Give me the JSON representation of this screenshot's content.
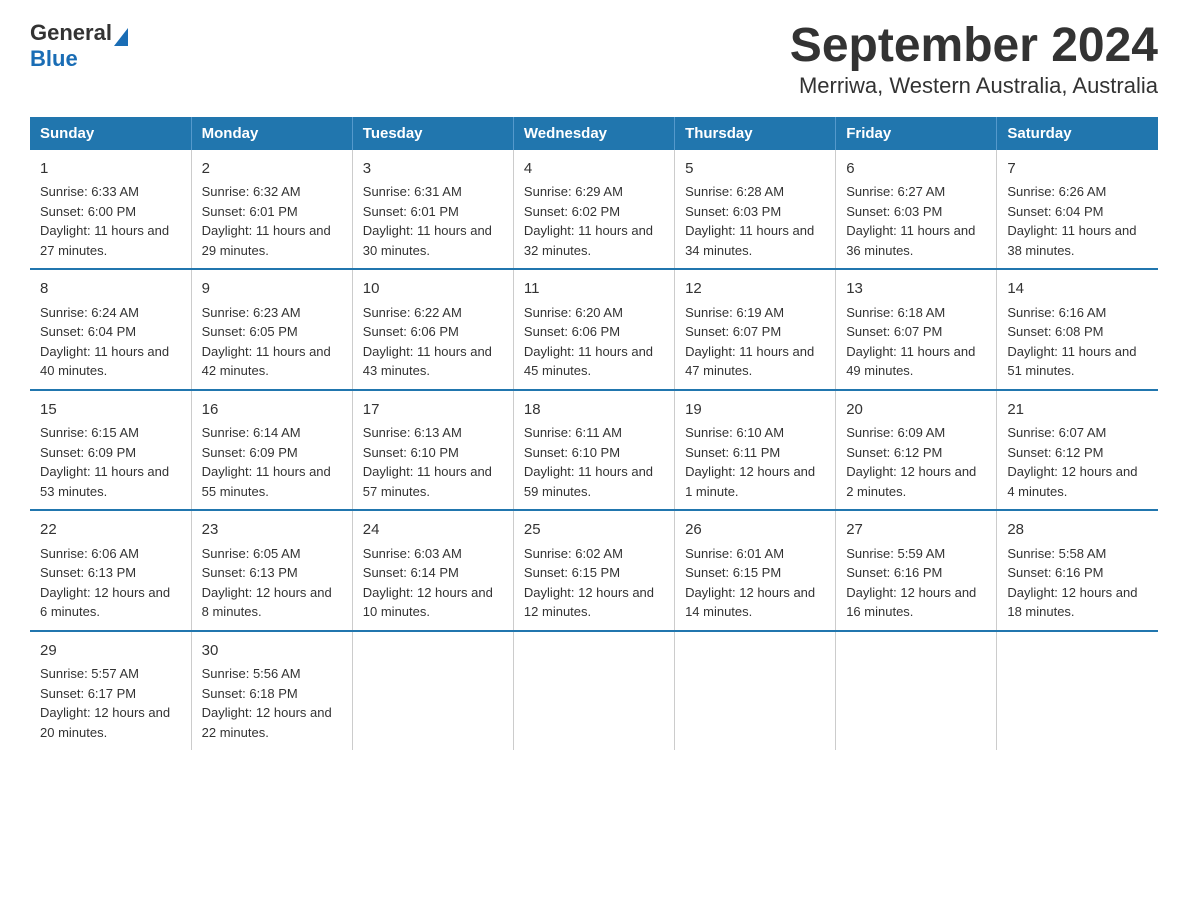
{
  "logo": {
    "general": "General",
    "triangle": "",
    "blue": "Blue"
  },
  "title": "September 2024",
  "subtitle": "Merriwa, Western Australia, Australia",
  "days_of_week": [
    "Sunday",
    "Monday",
    "Tuesday",
    "Wednesday",
    "Thursday",
    "Friday",
    "Saturday"
  ],
  "weeks": [
    [
      {
        "day": "1",
        "sunrise": "6:33 AM",
        "sunset": "6:00 PM",
        "daylight": "11 hours and 27 minutes."
      },
      {
        "day": "2",
        "sunrise": "6:32 AM",
        "sunset": "6:01 PM",
        "daylight": "11 hours and 29 minutes."
      },
      {
        "day": "3",
        "sunrise": "6:31 AM",
        "sunset": "6:01 PM",
        "daylight": "11 hours and 30 minutes."
      },
      {
        "day": "4",
        "sunrise": "6:29 AM",
        "sunset": "6:02 PM",
        "daylight": "11 hours and 32 minutes."
      },
      {
        "day": "5",
        "sunrise": "6:28 AM",
        "sunset": "6:03 PM",
        "daylight": "11 hours and 34 minutes."
      },
      {
        "day": "6",
        "sunrise": "6:27 AM",
        "sunset": "6:03 PM",
        "daylight": "11 hours and 36 minutes."
      },
      {
        "day": "7",
        "sunrise": "6:26 AM",
        "sunset": "6:04 PM",
        "daylight": "11 hours and 38 minutes."
      }
    ],
    [
      {
        "day": "8",
        "sunrise": "6:24 AM",
        "sunset": "6:04 PM",
        "daylight": "11 hours and 40 minutes."
      },
      {
        "day": "9",
        "sunrise": "6:23 AM",
        "sunset": "6:05 PM",
        "daylight": "11 hours and 42 minutes."
      },
      {
        "day": "10",
        "sunrise": "6:22 AM",
        "sunset": "6:06 PM",
        "daylight": "11 hours and 43 minutes."
      },
      {
        "day": "11",
        "sunrise": "6:20 AM",
        "sunset": "6:06 PM",
        "daylight": "11 hours and 45 minutes."
      },
      {
        "day": "12",
        "sunrise": "6:19 AM",
        "sunset": "6:07 PM",
        "daylight": "11 hours and 47 minutes."
      },
      {
        "day": "13",
        "sunrise": "6:18 AM",
        "sunset": "6:07 PM",
        "daylight": "11 hours and 49 minutes."
      },
      {
        "day": "14",
        "sunrise": "6:16 AM",
        "sunset": "6:08 PM",
        "daylight": "11 hours and 51 minutes."
      }
    ],
    [
      {
        "day": "15",
        "sunrise": "6:15 AM",
        "sunset": "6:09 PM",
        "daylight": "11 hours and 53 minutes."
      },
      {
        "day": "16",
        "sunrise": "6:14 AM",
        "sunset": "6:09 PM",
        "daylight": "11 hours and 55 minutes."
      },
      {
        "day": "17",
        "sunrise": "6:13 AM",
        "sunset": "6:10 PM",
        "daylight": "11 hours and 57 minutes."
      },
      {
        "day": "18",
        "sunrise": "6:11 AM",
        "sunset": "6:10 PM",
        "daylight": "11 hours and 59 minutes."
      },
      {
        "day": "19",
        "sunrise": "6:10 AM",
        "sunset": "6:11 PM",
        "daylight": "12 hours and 1 minute."
      },
      {
        "day": "20",
        "sunrise": "6:09 AM",
        "sunset": "6:12 PM",
        "daylight": "12 hours and 2 minutes."
      },
      {
        "day": "21",
        "sunrise": "6:07 AM",
        "sunset": "6:12 PM",
        "daylight": "12 hours and 4 minutes."
      }
    ],
    [
      {
        "day": "22",
        "sunrise": "6:06 AM",
        "sunset": "6:13 PM",
        "daylight": "12 hours and 6 minutes."
      },
      {
        "day": "23",
        "sunrise": "6:05 AM",
        "sunset": "6:13 PM",
        "daylight": "12 hours and 8 minutes."
      },
      {
        "day": "24",
        "sunrise": "6:03 AM",
        "sunset": "6:14 PM",
        "daylight": "12 hours and 10 minutes."
      },
      {
        "day": "25",
        "sunrise": "6:02 AM",
        "sunset": "6:15 PM",
        "daylight": "12 hours and 12 minutes."
      },
      {
        "day": "26",
        "sunrise": "6:01 AM",
        "sunset": "6:15 PM",
        "daylight": "12 hours and 14 minutes."
      },
      {
        "day": "27",
        "sunrise": "5:59 AM",
        "sunset": "6:16 PM",
        "daylight": "12 hours and 16 minutes."
      },
      {
        "day": "28",
        "sunrise": "5:58 AM",
        "sunset": "6:16 PM",
        "daylight": "12 hours and 18 minutes."
      }
    ],
    [
      {
        "day": "29",
        "sunrise": "5:57 AM",
        "sunset": "6:17 PM",
        "daylight": "12 hours and 20 minutes."
      },
      {
        "day": "30",
        "sunrise": "5:56 AM",
        "sunset": "6:18 PM",
        "daylight": "12 hours and 22 minutes."
      },
      null,
      null,
      null,
      null,
      null
    ]
  ],
  "labels": {
    "sunrise": "Sunrise:",
    "sunset": "Sunset:",
    "daylight": "Daylight:"
  }
}
